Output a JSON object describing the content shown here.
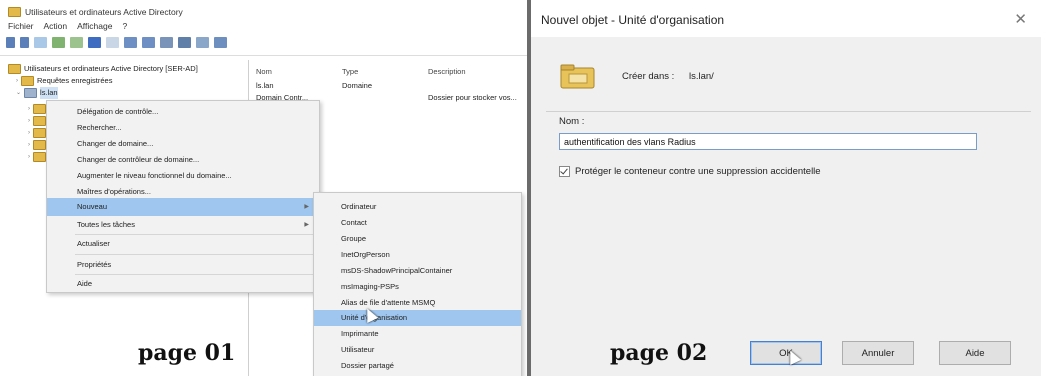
{
  "left": {
    "window_title": "Utilisateurs et ordinateurs Active Directory",
    "menu": [
      "Fichier",
      "Action",
      "Affichage",
      "?"
    ],
    "tree": {
      "root": "Utilisateurs et ordinateurs Active Directory [SER-AD]",
      "saved_queries": "Requêtes enregistrées",
      "domain": "ls.lan"
    },
    "list_headers": [
      "Nom",
      "Type",
      "Description"
    ],
    "list_rows": [
      [
        "ls.lan",
        "Domaine",
        ""
      ],
      [
        "Domain Contr...",
        "",
        "Dossier pour stocker vos..."
      ]
    ],
    "context_menu": [
      {
        "label": "Délégation de contrôle...",
        "highlight": false,
        "submenu": false
      },
      {
        "label": "Rechercher...",
        "highlight": false,
        "submenu": false
      },
      {
        "label": "Changer de domaine...",
        "highlight": false,
        "submenu": false
      },
      {
        "label": "Changer de contrôleur de domaine...",
        "highlight": false,
        "submenu": false
      },
      {
        "label": "Augmenter le niveau fonctionnel du domaine...",
        "highlight": false,
        "submenu": false
      },
      {
        "label": "Maîtres d'opérations...",
        "highlight": false,
        "submenu": false
      },
      {
        "label": "Nouveau",
        "highlight": true,
        "submenu": true
      },
      {
        "label": "Toutes les tâches",
        "highlight": false,
        "submenu": true
      },
      {
        "label": "Actualiser",
        "highlight": false,
        "submenu": false
      },
      {
        "label": "Propriétés",
        "highlight": false,
        "submenu": false
      },
      {
        "label": "Aide",
        "highlight": false,
        "submenu": false
      }
    ],
    "submenu": [
      {
        "label": "Ordinateur",
        "highlight": false
      },
      {
        "label": "Contact",
        "highlight": false
      },
      {
        "label": "Groupe",
        "highlight": false
      },
      {
        "label": "InetOrgPerson",
        "highlight": false
      },
      {
        "label": "msDS-ShadowPrincipalContainer",
        "highlight": false
      },
      {
        "label": "msImaging-PSPs",
        "highlight": false
      },
      {
        "label": "Alias de file d'attente MSMQ",
        "highlight": false
      },
      {
        "label": "Unité d'organisation",
        "highlight": true
      },
      {
        "label": "Imprimante",
        "highlight": false
      },
      {
        "label": "Utilisateur",
        "highlight": false
      },
      {
        "label": "Dossier partagé",
        "highlight": false
      }
    ],
    "caption": "page 01"
  },
  "right": {
    "dialog_title": "Nouvel objet - Unité d'organisation",
    "close_glyph": "✕",
    "create_in_label": "Créer dans :",
    "create_in_value": "ls.lan/",
    "name_label": "Nom :",
    "name_value": "authentification des vlans Radius",
    "protect_label": "Protéger le conteneur contre une suppression accidentelle",
    "protect_checked": true,
    "ok_label": "OK",
    "cancel_label": "Annuler",
    "help_label": "Aide",
    "caption": "page 02"
  }
}
